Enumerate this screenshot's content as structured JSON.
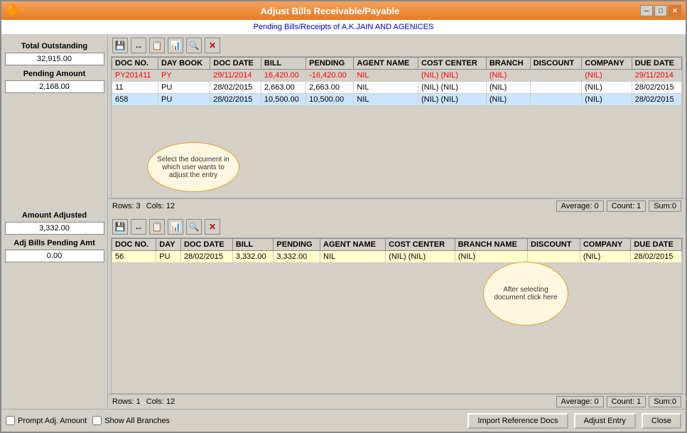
{
  "window": {
    "title": "Adjust Bills Receivable/Payable",
    "subtitle": "Pending Bills/Receipts of A.K.JAIN AND AGENICES"
  },
  "toolbar": {
    "icons": [
      "save",
      "resize",
      "copy",
      "table",
      "search",
      "delete"
    ]
  },
  "top_grid": {
    "columns": [
      "DOC NO.",
      "DAY BOOK",
      "DOC DATE",
      "BILL",
      "PENDING",
      "AGENT NAME",
      "COST CENTER",
      "BRANCH",
      "DISCOUNT",
      "COMPANY",
      "DUE DATE"
    ],
    "rows": [
      {
        "doc_no": "PY201411",
        "day_book": "PY",
        "doc_date": "29/11/2014",
        "bill": "16,420.00",
        "pending": "-16,420.00",
        "agent": "NIL",
        "cost_center": "(NIL) (NIL)",
        "branch": "(NIL)",
        "discount": "",
        "company": "(NIL)",
        "due_date": "29/11/2014",
        "style": "red"
      },
      {
        "doc_no": "11",
        "day_book": "PU",
        "doc_date": "28/02/2015",
        "bill": "2,663.00",
        "pending": "2,663.00",
        "agent": "NIL",
        "cost_center": "(NIL) (NIL)",
        "branch": "(NIL)",
        "discount": "",
        "company": "(NIL)",
        "due_date": "28/02/2015",
        "style": "normal"
      },
      {
        "doc_no": "658",
        "day_book": "PU",
        "doc_date": "28/02/2015",
        "bill": "10,500.00",
        "pending": "10,500.00",
        "agent": "NIL",
        "cost_center": "(NIL) (NIL)",
        "branch": "(NIL)",
        "discount": "",
        "company": "(NIL)",
        "due_date": "28/02/2015",
        "style": "selected"
      }
    ],
    "tooltip": "Select the document in which user wants to adjust the entry",
    "status": {
      "rows": "Rows: 3",
      "cols": "Cols: 12",
      "average": "Average: 0",
      "count": "Count: 1",
      "sum": "Sum:0"
    }
  },
  "stats": {
    "total_outstanding_label": "Total Outstanding",
    "total_outstanding_value": "32,915.00",
    "pending_amount_label": "Pending Amount",
    "pending_amount_value": "2,168.00",
    "amount_adjusted_label": "Amount Adjusted",
    "amount_adjusted_value": "3,332.00",
    "adj_bills_pending_label": "Adj Bills Pending Amt",
    "adj_bills_pending_value": "0.00"
  },
  "bottom_grid": {
    "columns": [
      "DOC NO.",
      "DAY",
      "DOC DATE",
      "BILL",
      "PENDING",
      "AGENT NAME",
      "COST CENTER",
      "BRANCH NAME",
      "DISCOUNT",
      "COMPANY",
      "DUE DATE"
    ],
    "rows": [
      {
        "doc_no": "56",
        "day": "PU",
        "doc_date": "28/02/2015",
        "bill": "3,332.00",
        "pending": "3,332.00",
        "agent": "NIL",
        "cost_center": "(NIL) (NIL)",
        "branch": "(NIL)",
        "discount": "",
        "company": "(NIL)",
        "due_date": "28/02/2015",
        "style": "highlight"
      }
    ],
    "tooltip": "After selecting document click here",
    "status": {
      "rows": "Rows: 1",
      "cols": "Cols: 12",
      "average": "Average: 0",
      "count": "Count: 1",
      "sum": "Sum:0"
    }
  },
  "bottom_bar": {
    "prompt_adj_label": "Prompt Adj. Amount",
    "show_all_branches_label": "Show All Branches",
    "import_ref_docs_btn": "Import Reference Docs",
    "adjust_entry_btn": "Adjust Entry",
    "close_btn": "Close"
  }
}
